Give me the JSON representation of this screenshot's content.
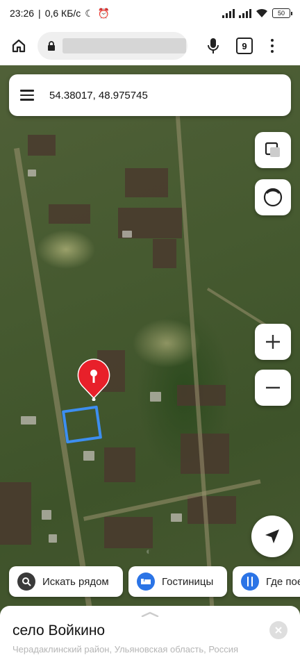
{
  "status_bar": {
    "time": "23:26",
    "speed": "0,6 КБ/с",
    "battery": "50"
  },
  "browser": {
    "tabs_count": "9"
  },
  "search": {
    "coordinates": "54.38017, 48.975745"
  },
  "map_controls": {
    "layers_icon": "layers-icon",
    "panorama_icon": "panorama-icon",
    "zoom_in_icon": "plus-icon",
    "zoom_out_icon": "minus-icon",
    "locate_icon": "navigation-arrow-icon"
  },
  "chips": [
    {
      "label": "Искать рядом",
      "icon": "search-icon",
      "color": "#3a3a3a"
    },
    {
      "label": "Гостиницы",
      "icon": "bed-icon",
      "color": "#2b74e6"
    },
    {
      "label": "Где пое",
      "icon": "fork-knife-icon",
      "color": "#2b74e6"
    }
  ],
  "place": {
    "name": "село Войкино",
    "subtitle": "Черадаклинский район, Ульяновская область, Россия"
  },
  "colors": {
    "pin": "#e8202a",
    "selection": "#3d8ef0",
    "accent": "#2b74e6"
  }
}
